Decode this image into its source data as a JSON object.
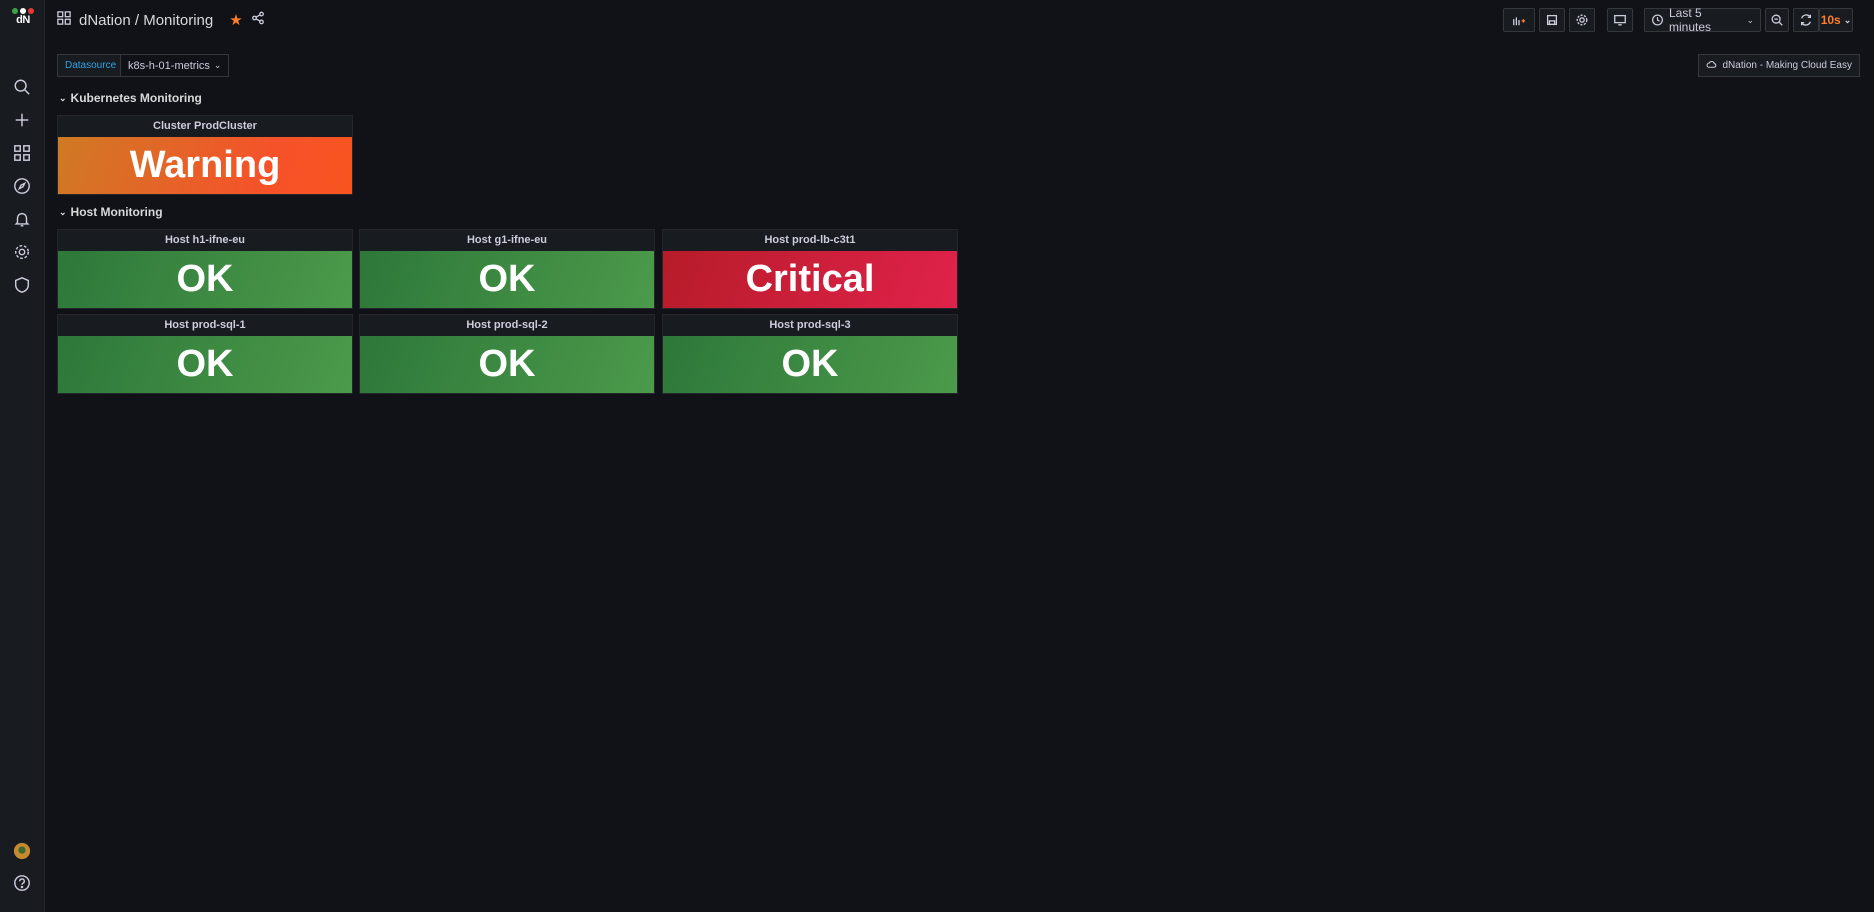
{
  "app": {
    "logo_text": "dN",
    "breadcrumb": "dNation / Monitoring"
  },
  "toolbar": {
    "time_range": "Last 5 minutes",
    "refresh_interval": "10s"
  },
  "variables": {
    "datasource_label": "Datasource",
    "datasource_value": "k8s-h-01-metrics"
  },
  "dashboard_link": "dNation - Making Cloud Easy",
  "rows": [
    {
      "title": "Kubernetes Monitoring"
    },
    {
      "title": "Host Monitoring"
    }
  ],
  "panels": [
    {
      "title": "Cluster ProdCluster",
      "status": "Warning"
    },
    {
      "title": "Host h1-ifne-eu",
      "status": "OK"
    },
    {
      "title": "Host g1-ifne-eu",
      "status": "OK"
    },
    {
      "title": "Host prod-lb-c3t1",
      "status": "Critical"
    },
    {
      "title": "Host prod-sql-1",
      "status": "OK"
    },
    {
      "title": "Host prod-sql-2",
      "status": "OK"
    },
    {
      "title": "Host prod-sql-3",
      "status": "OK"
    }
  ],
  "colors": {
    "ok": "#3f8f43",
    "warning": "#f5522a",
    "critical": "#d41f3c",
    "accent": "#33a2e5",
    "star": "#ff7f2a"
  }
}
